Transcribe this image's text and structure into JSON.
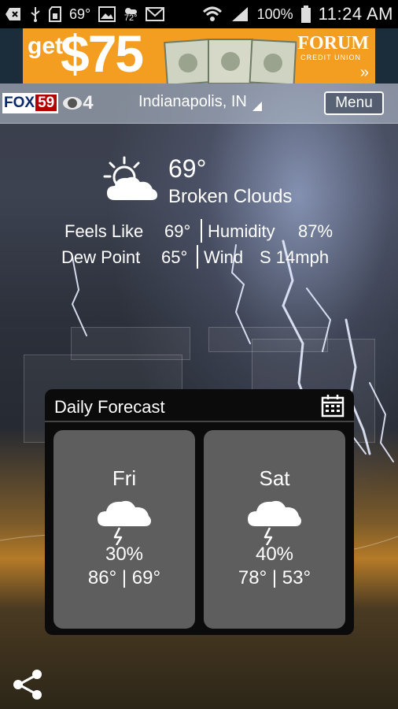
{
  "status_bar": {
    "temp_badge": "69°",
    "small_temp": "72°",
    "battery": "100%",
    "time": "11:24 AM"
  },
  "ad": {
    "get": "get",
    "amount": "$75",
    "brand": "FORUM",
    "brand_sub": "CREDIT UNION"
  },
  "header": {
    "logo_fox": "FOX",
    "logo_fox_num": "59",
    "logo_cbs_num": "4",
    "location": "Indianapolis, IN",
    "menu_label": "Menu"
  },
  "current": {
    "icon": "partly-cloudy-icon",
    "temperature": "69°",
    "condition": "Broken Clouds",
    "feels_like_label": "Feels Like",
    "feels_like_value": "69°",
    "humidity_label": "Humidity",
    "humidity_value": "87%",
    "dew_point_label": "Dew Point",
    "dew_point_value": "65°",
    "wind_label": "Wind",
    "wind_value": "S 14mph"
  },
  "daily_forecast": {
    "title": "Daily Forecast",
    "days": [
      {
        "name": "Fri",
        "icon": "thunderstorm-icon",
        "precip": "30%",
        "temps": "86° | 69°"
      },
      {
        "name": "Sat",
        "icon": "thunderstorm-icon",
        "precip": "40%",
        "temps": "78° | 53°"
      }
    ]
  },
  "colors": {
    "ad_orange": "#f39d21",
    "card_bg": "#0b0b0b",
    "day_card_bg": "#5e5e5e"
  }
}
